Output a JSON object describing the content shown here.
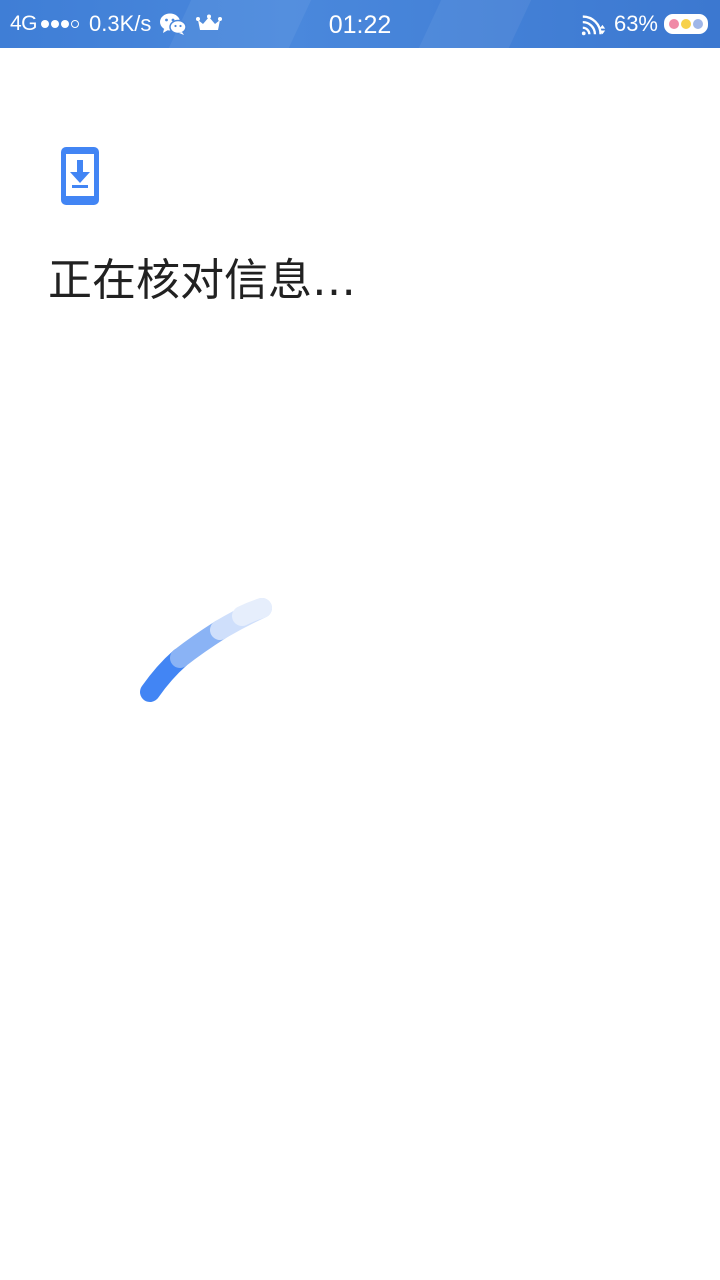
{
  "status_bar": {
    "network": "4G",
    "signal_strength": 3,
    "signal_max": 4,
    "data_speed": "0.3K/s",
    "notification_icons": [
      "wechat-icon",
      "crown-icon"
    ],
    "time": "01:22",
    "right_icons": [
      "wifi-signal-icon"
    ],
    "battery_percent": "63%"
  },
  "main": {
    "header_icon": "phone-download-icon",
    "title": "正在核对信息…"
  },
  "loader": {
    "icon": "loading-spinner-icon"
  },
  "colors": {
    "status_bar": "#3f7ed6",
    "accent": "#4285f4",
    "title_text": "#212121",
    "background": "#ffffff"
  }
}
